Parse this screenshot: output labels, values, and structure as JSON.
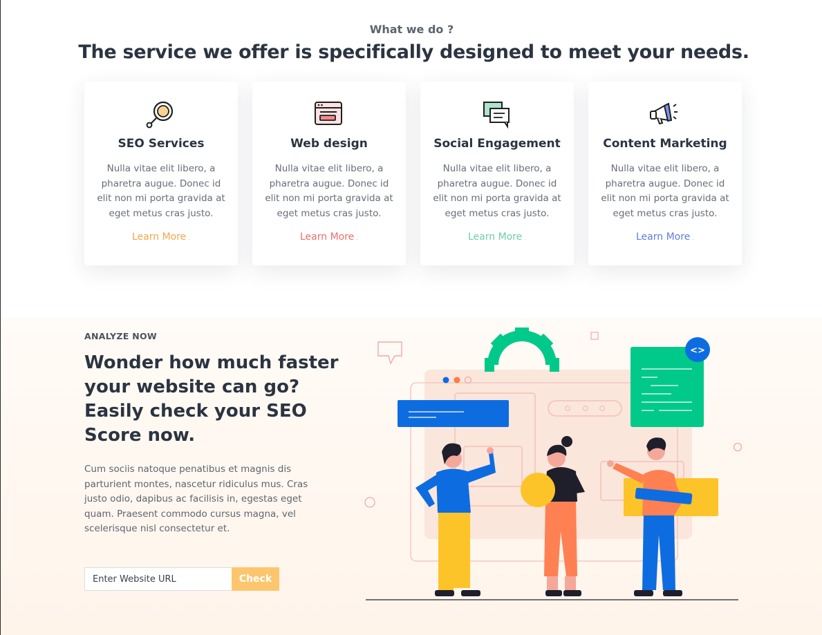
{
  "services": {
    "eyebrow": "What we do ?",
    "headline": "The service we offer is specifically designed to meet your needs.",
    "cards": [
      {
        "title": "SEO Services",
        "desc": "Nulla vitae elit libero, a pharetra augue. Donec id elit non mi porta gravida at eget metus cras justo.",
        "link": "Learn More",
        "accent": "#f4a54a",
        "icon": "magnifier-icon"
      },
      {
        "title": "Web design",
        "desc": "Nulla vitae elit libero, a pharetra augue. Donec id elit non mi porta gravida at eget metus cras justo.",
        "link": "Learn More",
        "accent": "#ef6d6d",
        "icon": "browser-window-icon"
      },
      {
        "title": "Social Engagement",
        "desc": "Nulla vitae elit libero, a pharetra augue. Donec id elit non mi porta gravida at eget metus cras justo.",
        "link": "Learn More",
        "accent": "#6ccfa6",
        "icon": "chat-bubbles-icon"
      },
      {
        "title": "Content Marketing",
        "desc": "Nulla vitae elit libero, a pharetra augue. Donec id elit non mi porta gravida at eget metus cras justo.",
        "link": "Learn More",
        "accent": "#5b7de0",
        "icon": "megaphone-icon"
      }
    ]
  },
  "analyze": {
    "tag": "ANALYZE NOW",
    "headline": "Wonder how much faster your website can go? Easily check your SEO Score now.",
    "paragraph": "Cum sociis natoque penatibus et magnis dis parturient montes, nascetur ridiculus mus. Cras justo odio, dapibus ac facilisis in, egestas eget quam. Praesent commodo cursus magna, vel scelerisque nisl consectetur et.",
    "input_placeholder": "Enter Website URL",
    "button_label": "Check",
    "code_badge": "<>"
  },
  "colors": {
    "orange": "#fdc66e",
    "blue": "#0d6de0",
    "green": "#00c98a",
    "text": "#2b3441"
  }
}
